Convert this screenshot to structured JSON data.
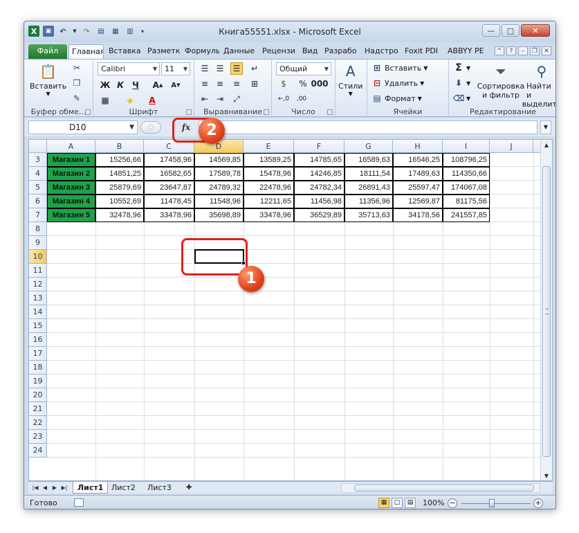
{
  "window": {
    "title": "Книга55551.xlsx - Microsoft Excel",
    "controls": {
      "minimize": "—",
      "maximize": "□",
      "close": "✕"
    }
  },
  "tabs": [
    {
      "label": "Файл"
    },
    {
      "label": "Главная"
    },
    {
      "label": "Вставка"
    },
    {
      "label": "Разметка"
    },
    {
      "label": "Формулы"
    },
    {
      "label": "Данные"
    },
    {
      "label": "Рецензи"
    },
    {
      "label": "Вид"
    },
    {
      "label": "Разрабо"
    },
    {
      "label": "Надстро"
    },
    {
      "label": "Foxit PDI"
    },
    {
      "label": "ABBYY PE"
    }
  ],
  "ribbon": {
    "clipboard": {
      "paste_label": "Вставить",
      "group_label": "Буфер обме..."
    },
    "font": {
      "font_name": "Calibri",
      "font_size": "11",
      "group_label": "Шрифт"
    },
    "alignment": {
      "group_label": "Выравнивание"
    },
    "number": {
      "format": "Общий",
      "group_label": "Число"
    },
    "styles": {
      "label": "Стили"
    },
    "cells": {
      "insert": "Вставить",
      "delete": "Удалить",
      "format": "Формат",
      "group_label": "Ячейки"
    },
    "editing": {
      "sort_line1": "Сортировка",
      "sort_line2": "и фильтр",
      "find_line1": "Найти и",
      "find_line2": "выделить",
      "group_label": "Редактирование",
      "sigma": "Σ"
    }
  },
  "formula_bar": {
    "name_box": "D10",
    "fx": "fx",
    "value": ""
  },
  "sheet": {
    "columns": [
      "A",
      "B",
      "C",
      "D",
      "E",
      "F",
      "G",
      "H",
      "I",
      "J"
    ],
    "rows": [
      "3",
      "4",
      "5",
      "6",
      "7",
      "8",
      "9",
      "10",
      "11",
      "12",
      "13",
      "14",
      "15",
      "16",
      "17",
      "18",
      "19",
      "20",
      "21",
      "22",
      "23",
      "24"
    ],
    "selected_cell": "D10",
    "data": [
      [
        "Магазин 1",
        "15256,66",
        "17458,96",
        "14569,85",
        "13589,25",
        "14785,65",
        "16589,63",
        "16546,25",
        "108796,25"
      ],
      [
        "Магазин 2",
        "14851,25",
        "16582,65",
        "17589,78",
        "15478,96",
        "14246,85",
        "18111,54",
        "17489,63",
        "114350,66"
      ],
      [
        "Магазин 3",
        "25879,69",
        "23647,87",
        "24789,32",
        "22478,96",
        "24782,34",
        "26891,43",
        "25597,47",
        "174067,08"
      ],
      [
        "Магазин 4",
        "10552,69",
        "11478,45",
        "11548,96",
        "12211,65",
        "11456,98",
        "11356,96",
        "12569,87",
        "81175,56"
      ],
      [
        "Магазин 5",
        "32478,96",
        "33478,96",
        "35698,89",
        "33478,96",
        "36529,89",
        "35713,63",
        "34178,56",
        "241557,85"
      ]
    ],
    "store_color": "#1fa24a"
  },
  "sheet_tabs": [
    "Лист1",
    "Лист2",
    "Лист3"
  ],
  "status": {
    "ready": "Готово",
    "zoom": "100%"
  },
  "callouts": {
    "one": "1",
    "two": "2",
    "color": "#e0201a"
  }
}
